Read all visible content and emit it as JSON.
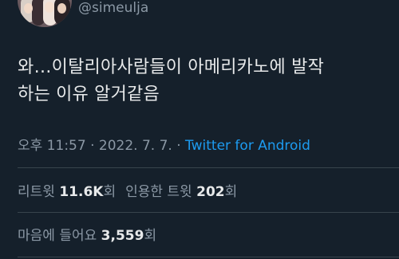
{
  "author": {
    "handle": "@simeulja"
  },
  "tweet": {
    "text": "와…이탈리아사람들이 아메리카노에 발작\n하는 이유 알거같음"
  },
  "meta": {
    "time": "오후 11:57",
    "separator": " · ",
    "date": "2022. 7. 7.",
    "source": "Twitter for Android"
  },
  "stats": {
    "retweets_label": "리트윗 ",
    "retweets_count": "11.6K",
    "retweets_unit": "회",
    "quotes_label": "인용한 트윗 ",
    "quotes_count": "202",
    "quotes_unit": "회",
    "likes_label": "마음에 들어요 ",
    "likes_count": "3,559",
    "likes_unit": "회"
  },
  "colors": {
    "background": "#15202b",
    "text_primary": "#e7e9ea",
    "text_secondary": "#8b98a5",
    "link": "#1d9bf0",
    "divider": "#38444d"
  }
}
